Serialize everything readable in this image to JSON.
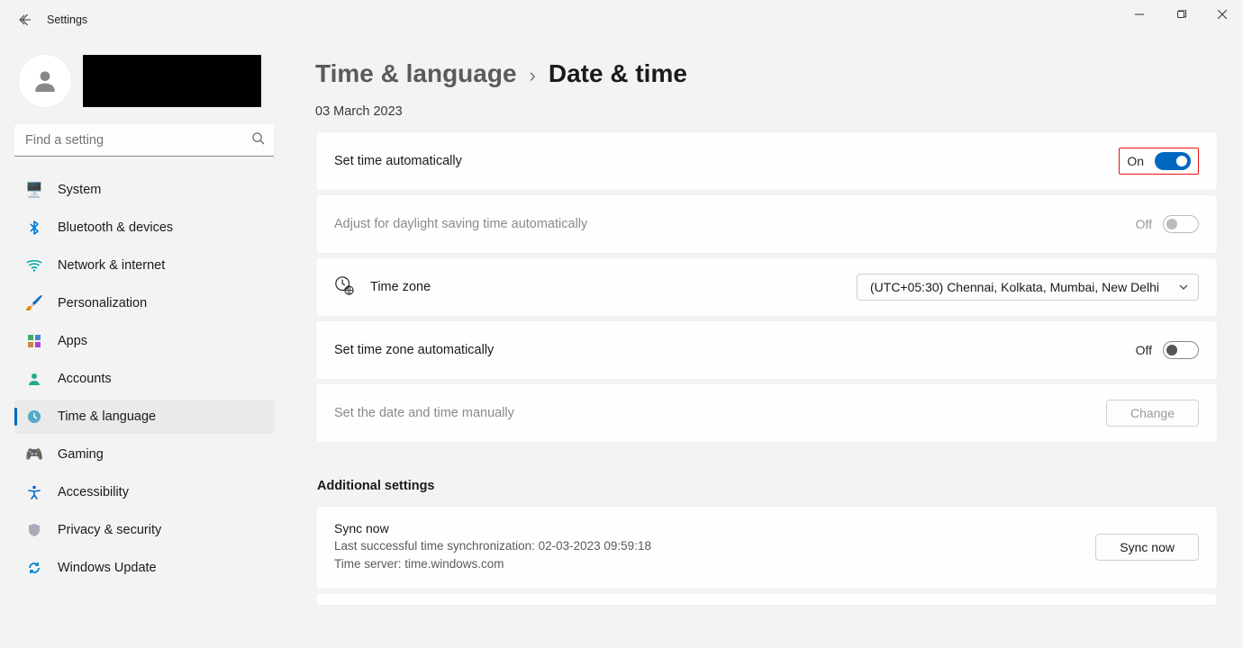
{
  "window": {
    "title": "Settings"
  },
  "search": {
    "placeholder": "Find a setting"
  },
  "sidebar": {
    "items": [
      {
        "label": "System",
        "icon": "🖥️"
      },
      {
        "label": "Bluetooth & devices",
        "icon": "bt"
      },
      {
        "label": "Network & internet",
        "icon": "📶"
      },
      {
        "label": "Personalization",
        "icon": "🖌️"
      },
      {
        "label": "Apps",
        "icon": "▦"
      },
      {
        "label": "Accounts",
        "icon": "👤"
      },
      {
        "label": "Time & language",
        "icon": "🕑"
      },
      {
        "label": "Gaming",
        "icon": "🎮"
      },
      {
        "label": "Accessibility",
        "icon": "acc"
      },
      {
        "label": "Privacy & security",
        "icon": "🛡️"
      },
      {
        "label": "Windows Update",
        "icon": "🔄"
      }
    ],
    "active_index": 6
  },
  "breadcrumb": {
    "parent": "Time & language",
    "current": "Date & time"
  },
  "current_date": "03 March 2023",
  "settings": {
    "auto_time": {
      "label": "Set time automatically",
      "state": "On"
    },
    "dst": {
      "label": "Adjust for daylight saving time automatically",
      "state": "Off"
    },
    "timezone": {
      "label": "Time zone",
      "value": "(UTC+05:30) Chennai, Kolkata, Mumbai, New Delhi"
    },
    "auto_tz": {
      "label": "Set time zone automatically",
      "state": "Off"
    },
    "manual": {
      "label": "Set the date and time manually",
      "button": "Change"
    }
  },
  "additional": {
    "heading": "Additional settings",
    "sync": {
      "title": "Sync now",
      "last_sync": "Last successful time synchronization: 02-03-2023 09:59:18",
      "server": "Time server: time.windows.com",
      "button": "Sync now"
    }
  }
}
